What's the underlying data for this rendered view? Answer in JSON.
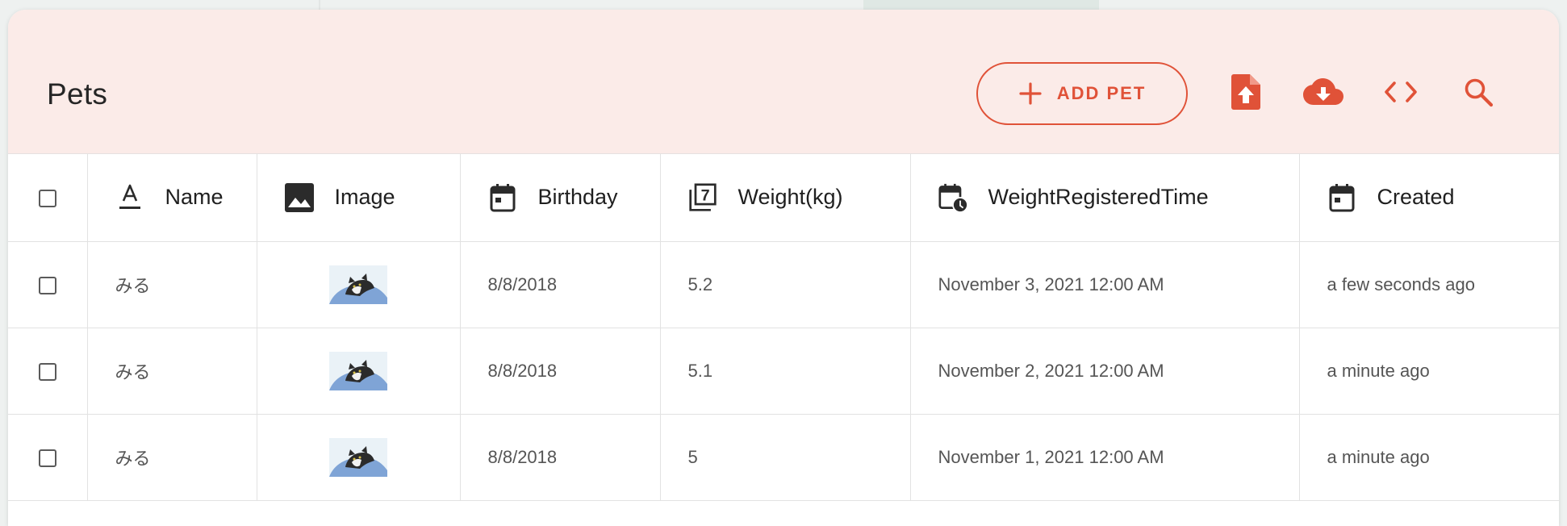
{
  "header": {
    "title": "Pets",
    "add_button_label": "ADD PET",
    "accent_color": "#e05238",
    "background_color": "#fbebe8",
    "icons": [
      "plus-icon",
      "file-upload-icon",
      "cloud-download-icon",
      "code-icon",
      "search-icon"
    ]
  },
  "table": {
    "columns": [
      {
        "label": "Name",
        "icon": "text-format-icon"
      },
      {
        "label": "Image",
        "icon": "image-icon"
      },
      {
        "label": "Birthday",
        "icon": "calendar-icon"
      },
      {
        "label": "Weight(kg)",
        "icon": "number-icon"
      },
      {
        "label": "WeightRegisteredTime",
        "icon": "calendar-clock-icon"
      },
      {
        "label": "Created",
        "icon": "calendar-icon"
      }
    ],
    "number_icon_digit": "7",
    "rows": [
      {
        "name": "みる",
        "image": "cat-photo",
        "birthday": "8/8/2018",
        "weight": "5.2",
        "weight_registered": "November 3, 2021 12:00 AM",
        "created": "a few seconds ago"
      },
      {
        "name": "みる",
        "image": "cat-photo",
        "birthday": "8/8/2018",
        "weight": "5.1",
        "weight_registered": "November 2, 2021 12:00 AM",
        "created": "a minute ago"
      },
      {
        "name": "みる",
        "image": "cat-photo",
        "birthday": "8/8/2018",
        "weight": "5",
        "weight_registered": "November 1, 2021 12:00 AM",
        "created": "a minute ago"
      }
    ]
  }
}
